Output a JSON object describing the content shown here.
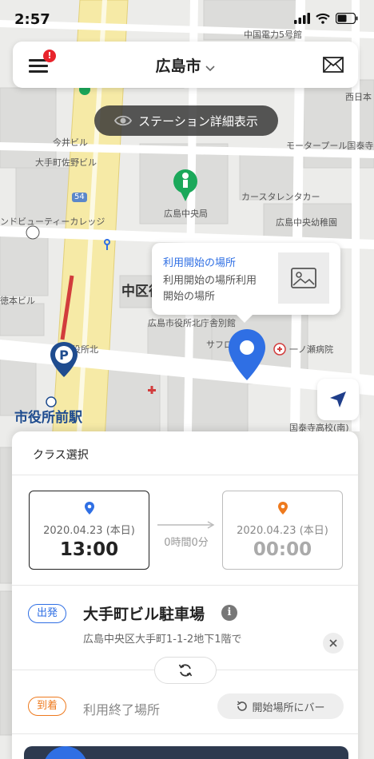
{
  "status_bar": {
    "time": "2:57"
  },
  "header": {
    "title": "広島市",
    "menu_badge": "!"
  },
  "station_toggle": {
    "label": "ステーション詳細表示"
  },
  "map": {
    "labels": {
      "chuden": "中国電力5号館",
      "nishijuji": "西日本",
      "imai": "今井ビル",
      "otemachi_sano": "大手町佐野ビル",
      "motor_pool": "モータープール国泰寺",
      "beauty_college": "ンドビューティーカレッジ",
      "central_post": "広島中央局",
      "car_rental": "カースタレンタカー",
      "kindergarten": "広島中央幼稚園",
      "naka_ward": "中区役",
      "city_annex": "広島市役所北庁舎別館",
      "tokumoto": "徳本ビル",
      "shiyakusho_kita": "役所北",
      "safuro": "サフロ",
      "ichinose": "一ノ瀬病院",
      "kokutaiji_hs": "国泰寺高校(南)",
      "station": "市役所前駅",
      "route54": "54"
    }
  },
  "popup": {
    "title": "利用開始の場所",
    "body": "利用開始の場所利用開始の場所"
  },
  "sheet": {
    "class_select": "クラス選択",
    "start": {
      "date": "2020.04.23 (本日)",
      "time": "13:00"
    },
    "end": {
      "date": "2020.04.23 (本日)",
      "time": "00:00"
    },
    "duration": "0時間0分",
    "depart_badge": "出発",
    "depart_name": "大手町ビル駐車場",
    "depart_address": "広島中央区大手町1-1-2地下1階で",
    "arrive_badge": "到着",
    "arrive_name": "利用終了場所",
    "reset_label": "開始場所にバー"
  },
  "colors": {
    "accent_blue": "#2f6fe4",
    "accent_orange": "#ee7a1e",
    "post_green": "#1ba85a"
  },
  "icons": [
    "menu-icon",
    "mail-icon",
    "eye-icon",
    "image-icon",
    "location-arrow-icon",
    "refresh-icon",
    "close-icon",
    "info-icon",
    "pin-icon",
    "parking-icon"
  ]
}
